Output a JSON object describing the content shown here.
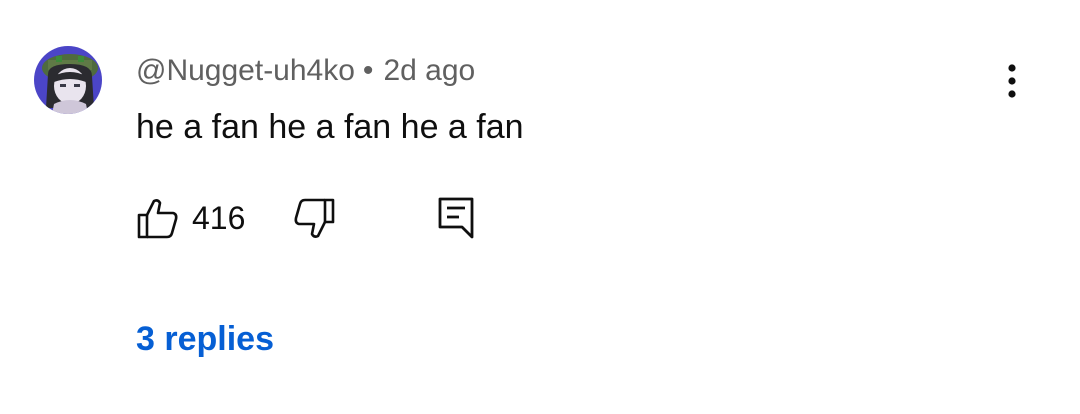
{
  "comment": {
    "author": "@Nugget-uh4ko",
    "separator": "•",
    "time": "2d ago",
    "text": "he a fan he a fan he a fan",
    "like_count": "416",
    "replies_label": "3 replies",
    "avatar_icon": "anime-character-avatar",
    "more_icon": "more-vertical-icon",
    "like_icon": "thumbs-up-icon",
    "dislike_icon": "thumbs-down-icon",
    "reply_icon": "reply-comment-icon"
  },
  "colors": {
    "primary_text": "#0f0f0f",
    "secondary_text": "#606060",
    "link": "#065fd4",
    "background": "#ffffff"
  }
}
